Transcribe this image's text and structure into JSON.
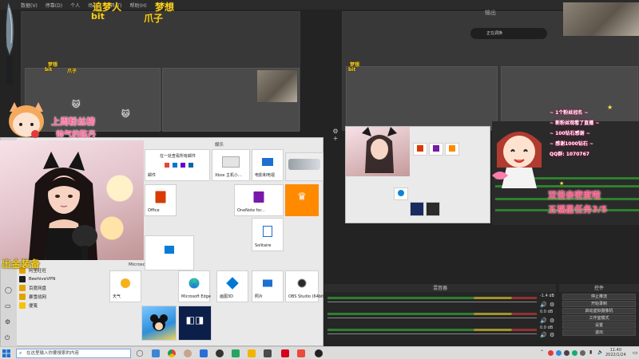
{
  "menubar": {
    "items": [
      "数据(V)",
      "停靠(D)",
      "个人",
      "场景",
      "工具(T)",
      "帮助(H)"
    ]
  },
  "obs": {
    "program_title": "输出",
    "studio_bar_label": "正在调换",
    "mixer_title": "混音器",
    "controls_title": "控件",
    "controls": [
      "停止推流",
      "开始录制",
      "启动虚拟摄像机",
      "工作室模式",
      "设置",
      "退出"
    ],
    "volume_readouts": [
      "-1.4 dB",
      "0.0 dB",
      "0.0 dB"
    ]
  },
  "overlay": {
    "top_name_line1": "追梦人",
    "top_name_line1b": "bit",
    "top_name_line2": "梦想",
    "top_name_line2b": "爪子",
    "gift_banner": "上周粉丝榜",
    "gift_banner_sub": "帅气的陈丹",
    "bottom_left_caption": "出金装备",
    "double_drop": "双倍亲密度啦",
    "task_progress": "五福星任务3/5",
    "right_chat_lines": [
      "~ 1个粉丝冠名 ~",
      "~ 新粉丝观看了直播 ~",
      "~ 100钻石感谢 ~",
      "~ 感谢1000钻石 ~",
      "QQ群: 1070767"
    ],
    "small_labels_preview": [
      "梦想",
      "bit",
      "爪子"
    ]
  },
  "start_menu": {
    "section_entertainment": "娱乐",
    "section_store": "Microsoft Store",
    "outlook_hint": "在一处查看所有邮件",
    "mail_label": "邮件",
    "apps": [
      {
        "name": "阿里旺旺"
      },
      {
        "name": "BeehiveVPN"
      },
      {
        "name": "百度网盘"
      },
      {
        "name": "暴雪战网"
      },
      {
        "name": "便笺"
      }
    ],
    "tiles": {
      "xbox": "Xbox 主机小...",
      "movies": "电影和电视",
      "office": "Office",
      "onenote": "OneNote for...",
      "solitaire": "Solitaire",
      "weather": "天气",
      "edge": "Microsoft Edge",
      "paint3d": "画图3D",
      "photos": "照片",
      "obs": "OBS Studio (64bit)"
    }
  },
  "taskbar": {
    "search_placeholder": "在这里输入你要搜索的内容",
    "clock_time": "11:40",
    "clock_date": "2022/1/24"
  },
  "colors": {
    "overlay_gold": "#f3d12a",
    "overlay_pink": "#ff5e94",
    "obs_dark": "#232323",
    "start_bg": "#e9e9e9",
    "office_red": "#d83b01",
    "onenote_purple": "#7719aa",
    "crown_orange": "#ff8a00"
  }
}
